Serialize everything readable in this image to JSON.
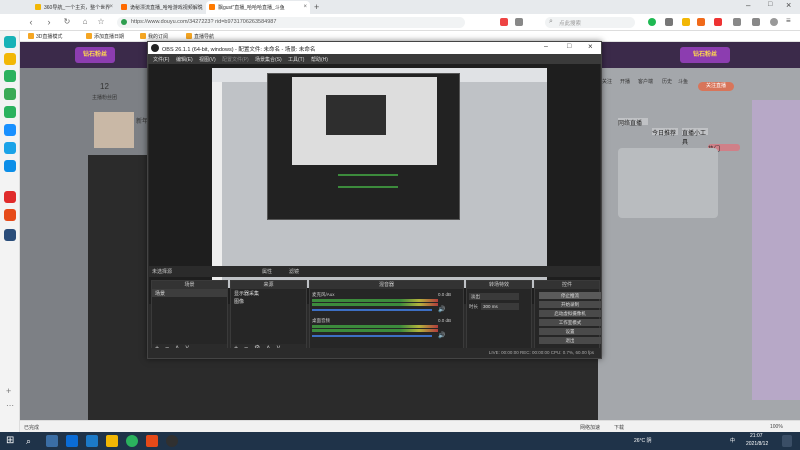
{
  "browser": {
    "tabs": [
      {
        "title": "360导航_一个主页，整个世界",
        "active": false,
        "color": "#f2b705"
      },
      {
        "title": "诡秘漂流直播_哈哈游戏视频解说",
        "active": false,
        "color": "#ff6a00"
      },
      {
        "title": "飘gust\"直播_哈哈哈直播_斗鱼",
        "active": true,
        "color": "#ff7a00"
      }
    ],
    "url": "https://www.douyu.com/3427223? rid=b9731706263584987",
    "search_placeholder": "点此搜索",
    "bookmarks": [
      "3D直播模式",
      "添加直播日期",
      "我的订阅",
      "直播导航"
    ]
  },
  "page": {
    "header_brand": "钻石粉丝",
    "follow_count": "12",
    "follow_label": "主播粉丝团",
    "streamer_name": "新年",
    "right_nav": [
      "关注",
      "开播",
      "客户端",
      "历史",
      "斗鱼"
    ],
    "live_label": "关注直播",
    "bottom_tags": [
      "网络直播",
      "今日推荐",
      "直播小工具",
      "热门"
    ]
  },
  "obs": {
    "title": "OBS 26.1.1 (64-bit, windows) - 配置文件: 未命名 - 场景: 未命名",
    "menu": [
      "文件(F)",
      "编辑(E)",
      "视图(V)",
      "配置文件(P)",
      "场景集合(S)",
      "工具(T)",
      "帮助(H)"
    ],
    "scene_label": "未选择源",
    "props_label": "属性",
    "filters_label": "滤镜",
    "docks": {
      "scenes": {
        "title": "场景",
        "items": [
          "场景"
        ]
      },
      "sources": {
        "title": "来源",
        "items": [
          "显示器采集",
          "图像"
        ]
      },
      "mixer": {
        "title": "混音器",
        "channels": [
          {
            "name": "麦克风/Aux",
            "level": "0.0 dB"
          },
          {
            "name": "桌面音频",
            "level": "0.0 dB"
          }
        ]
      },
      "transitions": {
        "title": "转场特效",
        "type": "淡出",
        "duration_label": "时长",
        "duration": "300 ms"
      },
      "controls": {
        "title": "控件",
        "buttons": [
          "停止推流",
          "开始录制",
          "启动虚拟摄像机",
          "工作室模式",
          "设置",
          "退出"
        ]
      }
    },
    "status": "LIVE: 00:00:00   REC: 00:00:00   CPU: 0.7%, 60.00 fps"
  },
  "taskbar": {
    "weather": "26°C 阴",
    "lang": "中",
    "time": "21:07",
    "date": "2021/8/12"
  },
  "statusbar": {
    "left": "已完成",
    "right": [
      "网络加速",
      "下载",
      "100%"
    ]
  }
}
